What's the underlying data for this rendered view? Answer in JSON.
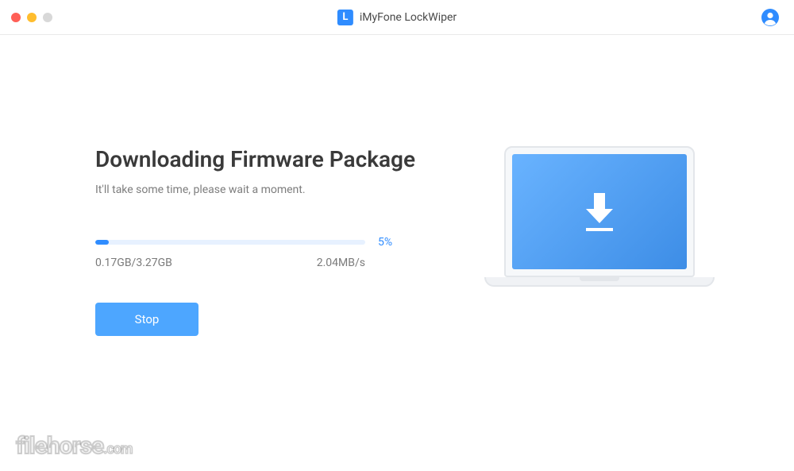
{
  "titlebar": {
    "app_logo_letter": "L",
    "app_title": "iMyFone LockWiper"
  },
  "main": {
    "heading": "Downloading Firmware Package",
    "subtext": "It'll take some time, please wait a moment.",
    "progress": {
      "percent_label": "5%",
      "percent_value": 5,
      "downloaded": "0.17GB",
      "total": "3.27GB",
      "size_label": "0.17GB/3.27GB",
      "speed": "2.04MB/s"
    },
    "stop_label": "Stop"
  },
  "watermark": {
    "name": "filehorse",
    "domain": ".com"
  },
  "colors": {
    "accent": "#2f8cff",
    "button": "#4da6ff"
  }
}
